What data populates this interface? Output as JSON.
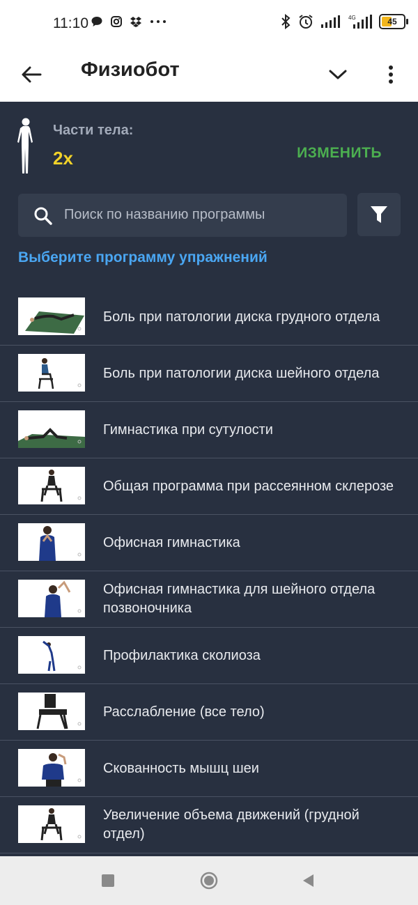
{
  "status_bar": {
    "time": "11:10",
    "battery": "45",
    "network": "4G"
  },
  "app_bar": {
    "title": "Физиобот"
  },
  "body_parts": {
    "label": "Части тела:",
    "value": "2x",
    "change_label": "ИЗМЕНИТЬ"
  },
  "search": {
    "placeholder": "Поиск по названию программы"
  },
  "section_heading": "Выберите программу упражнений",
  "programs": [
    {
      "label": "Боль при патологии диска грудного отдела"
    },
    {
      "label": "Боль при патологии диска шейного отдела"
    },
    {
      "label": "Гимнастика при сутулости"
    },
    {
      "label": "Общая программа при рассеянном склерозе"
    },
    {
      "label": "Офисная гимнастика"
    },
    {
      "label": "Офисная гимнастика для шейного отдела позвоночника"
    },
    {
      "label": "Профилактика сколиоза"
    },
    {
      "label": "Расслабление (все тело)"
    },
    {
      "label": "Скованность мышц шеи"
    },
    {
      "label": "Увеличение объема движений (грудной отдел)"
    }
  ],
  "colors": {
    "background": "#283040",
    "accent_yellow": "#f2d229",
    "accent_green": "#4caf50",
    "accent_blue": "#4aa6f2"
  }
}
